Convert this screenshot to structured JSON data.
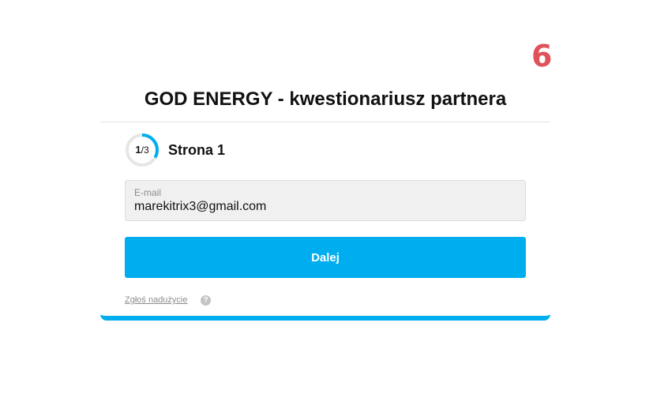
{
  "corner_number": "6",
  "form": {
    "title": "GOD ENERGY - kwestionariusz partnera",
    "progress": {
      "current": "1",
      "separator": "/3",
      "fraction_complete": 0.3333
    },
    "page_label": "Strona 1",
    "email": {
      "label": "E-mail",
      "value": "marekitrix3@gmail.com"
    },
    "next_button_label": "Dalej",
    "report_link": "Zgłoś nadużycie",
    "help_icon_glyph": "?"
  },
  "colors": {
    "accent": "#00aeef",
    "corner_number": "#e0525a",
    "field_background": "#f0f0f0"
  }
}
